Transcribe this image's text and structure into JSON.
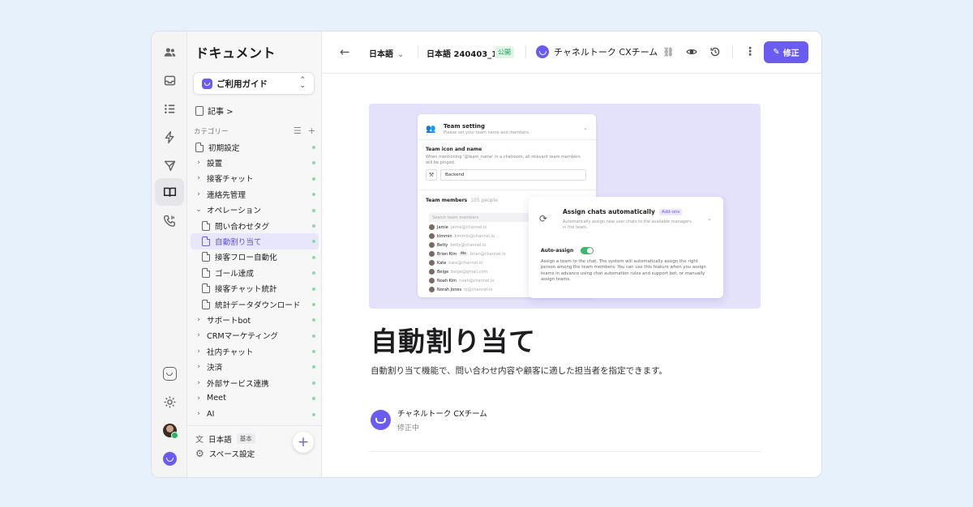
{
  "rail": {
    "items": [
      "users-icon",
      "inbox-icon",
      "list-icon",
      "bolt-icon",
      "send-icon",
      "book-icon",
      "phone-icon"
    ],
    "bottom": [
      "channel-logo-icon",
      "gear-icon",
      "avatar",
      "channel-brand-icon"
    ]
  },
  "sidebar": {
    "title": "ドキュメント",
    "guide_label": "ご利用ガイド",
    "articles_label": "記事 >",
    "category_label": "カテゴリー",
    "tree": [
      {
        "label": "初期設定",
        "level": 0,
        "type": "doc"
      },
      {
        "label": "設置",
        "level": 0,
        "type": "folder"
      },
      {
        "label": "接客チャット",
        "level": 0,
        "type": "folder"
      },
      {
        "label": "連絡先管理",
        "level": 0,
        "type": "folder"
      },
      {
        "label": "オペレーション",
        "level": 0,
        "type": "open"
      },
      {
        "label": "問い合わせタグ",
        "level": 1,
        "type": "doc"
      },
      {
        "label": "自動割り当て",
        "level": 1,
        "type": "doc",
        "selected": true
      },
      {
        "label": "接客フロー自動化",
        "level": 1,
        "type": "doc"
      },
      {
        "label": "ゴール達成",
        "level": 1,
        "type": "doc"
      },
      {
        "label": "接客チャット統計",
        "level": 1,
        "type": "doc"
      },
      {
        "label": "統計データダウンロード",
        "level": 1,
        "type": "doc"
      },
      {
        "label": "サポートbot",
        "level": 0,
        "type": "folder"
      },
      {
        "label": "CRMマーケティング",
        "level": 0,
        "type": "folder"
      },
      {
        "label": "社内チャット",
        "level": 0,
        "type": "folder"
      },
      {
        "label": "決済",
        "level": 0,
        "type": "folder"
      },
      {
        "label": "外部サービス連携",
        "level": 0,
        "type": "folder"
      },
      {
        "label": "Meet",
        "level": 0,
        "type": "folder"
      },
      {
        "label": "AI",
        "level": 0,
        "type": "folder"
      }
    ],
    "language": "日本語",
    "language_badge": "基本",
    "space_settings": "スペース設定",
    "status_color": "#8fd9a6"
  },
  "topbar": {
    "language": "日本語",
    "version": "日本語 240403_1",
    "public_badge": "公開",
    "team_name": "チャネルトーク CXチーム",
    "edit_label": "修正",
    "accent": "#6b5cf0"
  },
  "hero": {
    "card1": {
      "title": "Team setting",
      "subtitle": "Please set your team name and members.",
      "section_title": "Team icon and name",
      "section_desc": "When mentioning '@team_name' in a chatroom, all relevant team members will be pinged.",
      "name_value": "Backend",
      "members_title": "Team members",
      "members_count": "105 people",
      "search_placeholder": "Search team members",
      "members": [
        {
          "name": "Jamie",
          "email": "jamie@channel.io"
        },
        {
          "name": "kimmin",
          "email": "kimmin@channel.io"
        },
        {
          "name": "Betty",
          "email": "betty@channel.io"
        },
        {
          "name": "Brian Kim",
          "tag": "Me",
          "email": "brian@channel.io"
        },
        {
          "name": "Kate",
          "email": "kate@channel.io"
        },
        {
          "name": "Beige",
          "email": "beige@gmail.com"
        },
        {
          "name": "Noah Kim",
          "email": "noah@channel.io"
        },
        {
          "name": "Norah Jones",
          "email": "nj@channel.io"
        }
      ]
    },
    "card2": {
      "title": "Assign chats automatically",
      "badge": "Add-ons",
      "subtitle": "Automatically assign new user chats to the available managers in the team.",
      "toggle_label": "Auto-assign",
      "toggle_on": true,
      "description": "Assign a team to the chat. The system will automatically assign the right person among the team members. You can use this feature when you assign teams in advance using chat automation rules and support bot, or manually assign teams."
    }
  },
  "doc": {
    "title": "自動割り当て",
    "description": "自動割り当て機能で、問い合わせ内容や顧客に適した担当者を指定できます。",
    "author": "チャネルトーク CXチーム",
    "status": "修正中"
  }
}
